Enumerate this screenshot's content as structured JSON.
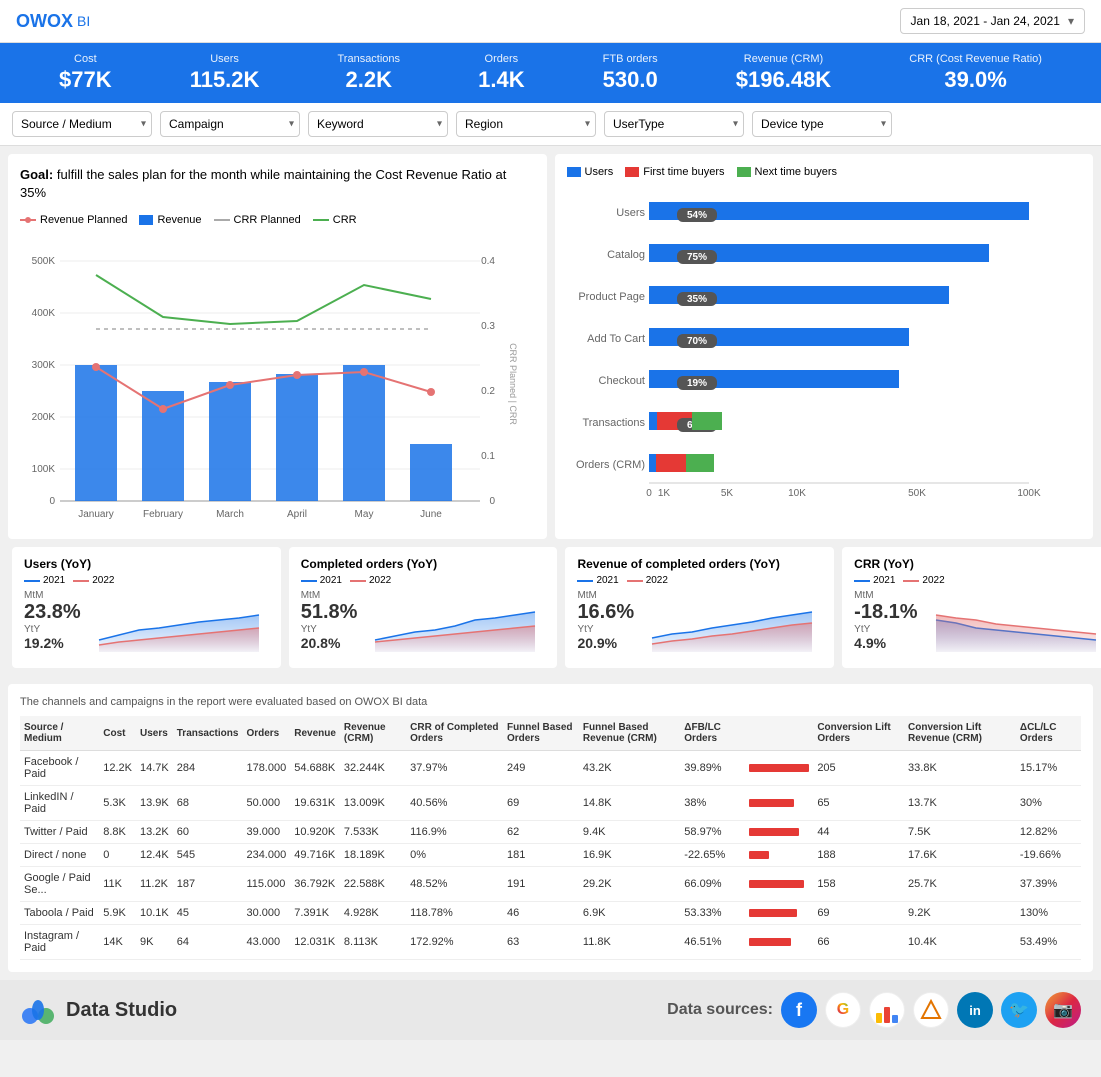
{
  "header": {
    "logo": "OWOX",
    "logo_suffix": "BI",
    "date_range": "Jan 18, 2021 - Jan 24, 2021"
  },
  "kpis": [
    {
      "label": "Cost",
      "value": "$77K"
    },
    {
      "label": "Users",
      "value": "115.2K"
    },
    {
      "label": "Transactions",
      "value": "2.2K"
    },
    {
      "label": "Orders",
      "value": "1.4K"
    },
    {
      "label": "FTB orders",
      "value": "530.0"
    },
    {
      "label": "Revenue (CRM)",
      "value": "$196.48K"
    },
    {
      "label": "CRR (Cost Revenue Ratio)",
      "value": "39.0%"
    }
  ],
  "filters": [
    {
      "label": "Source / Medium",
      "value": "Source / Medium"
    },
    {
      "label": "Campaign",
      "value": "Campaign"
    },
    {
      "label": "Keyword",
      "value": "Keyword"
    },
    {
      "label": "Region",
      "value": "Region"
    },
    {
      "label": "UserType",
      "value": "UserType"
    },
    {
      "label": "Device type",
      "value": "Device type"
    }
  ],
  "goal_text": "Goal: fulfill the sales plan for the month while maintaining the Cost Revenue Ratio at 35%",
  "chart1": {
    "legend": [
      {
        "label": "Revenue Planned",
        "color": "#e57373",
        "type": "line-dot"
      },
      {
        "label": "Revenue",
        "color": "#1a73e8",
        "type": "bar"
      },
      {
        "label": "CRR Planned",
        "color": "#aaa",
        "type": "line"
      },
      {
        "label": "CRR",
        "color": "#4caf50",
        "type": "line"
      }
    ],
    "months": [
      "January",
      "February",
      "March",
      "April",
      "May",
      "June"
    ],
    "y_left": [
      "500K",
      "400K",
      "300K",
      "200K",
      "100K",
      "0"
    ],
    "y_right": [
      "0.4",
      "0.3",
      "0.2",
      "0.1",
      "0"
    ]
  },
  "chart2": {
    "legend": [
      {
        "label": "Users",
        "color": "#1a73e8"
      },
      {
        "label": "First time buyers",
        "color": "#e53935"
      },
      {
        "label": "Next time buyers",
        "color": "#4caf50"
      }
    ],
    "categories": [
      "Users",
      "Catalog",
      "Product Page",
      "Add To Cart",
      "Checkout",
      "Transactions",
      "Orders (CRM)"
    ],
    "percentages": [
      "54%",
      "75%",
      "35%",
      "70%",
      "19%",
      "63%",
      ""
    ],
    "x_labels": [
      "0",
      "1K",
      "5K",
      "10K",
      "50K",
      "100K"
    ]
  },
  "small_charts": [
    {
      "title": "Users (YoY)",
      "mtm_label": "MtM",
      "mtm_value": "23.8%",
      "yty_label": "YtY",
      "yty_value": "19.2%",
      "legend": [
        {
          "label": "2021",
          "color": "#1a73e8"
        },
        {
          "label": "2022",
          "color": "#e57373"
        }
      ]
    },
    {
      "title": "Completed orders (YoY)",
      "mtm_label": "MtM",
      "mtm_value": "51.8%",
      "yty_label": "YtY",
      "yty_value": "20.8%",
      "legend": [
        {
          "label": "2021",
          "color": "#1a73e8"
        },
        {
          "label": "2022",
          "color": "#e57373"
        }
      ]
    },
    {
      "title": "Revenue of completed orders (YoY)",
      "mtm_label": "MtM",
      "mtm_value": "16.6%",
      "yty_label": "YtY",
      "yty_value": "20.9%",
      "legend": [
        {
          "label": "2021",
          "color": "#1a73e8"
        },
        {
          "label": "2022",
          "color": "#e57373"
        }
      ]
    },
    {
      "title": "CRR (YoY)",
      "mtm_label": "MtM",
      "mtm_value": "-18.1%",
      "yty_label": "YtY",
      "yty_value": "4.9%",
      "legend": [
        {
          "label": "2021",
          "color": "#1a73e8"
        },
        {
          "label": "2022",
          "color": "#e57373"
        }
      ]
    }
  ],
  "table": {
    "note": "The channels and campaigns in the report were evaluated based on OWOX BI data",
    "headers": [
      "Source / Medium",
      "Cost",
      "Users",
      "Transactions",
      "Orders",
      "Revenue",
      "Revenue (CRM)",
      "CRR of Completed Orders",
      "Funnel Based Orders",
      "Funnel Based Revenue (CRM)",
      "ΔFB/LC Orders",
      "",
      "Conversion Lift Orders",
      "Conversion Lift Revenue (CRM)",
      "ΔCL/LC Orders"
    ],
    "rows": [
      {
        "source": "Facebook / Paid",
        "cost": "12.2K",
        "users": "14.7K",
        "trans": "284",
        "orders": "178.000",
        "revenue": "54.688K",
        "rev_crm": "32.244K",
        "crr": "37.97%",
        "fb_orders": "249",
        "fb_rev": "43.2K",
        "delta_fb": "39.89%",
        "bar1": 60,
        "cl_orders": "205",
        "cl_rev": "33.8K",
        "delta_cl": "15.17%",
        "bar2": 30
      },
      {
        "source": "LinkedIN / Paid",
        "cost": "5.3K",
        "users": "13.9K",
        "trans": "68",
        "orders": "50.000",
        "revenue": "19.631K",
        "rev_crm": "13.009K",
        "crr": "40.56%",
        "fb_orders": "69",
        "fb_rev": "14.8K",
        "delta_fb": "38%",
        "bar1": 45,
        "cl_orders": "65",
        "cl_rev": "13.7K",
        "delta_cl": "30%",
        "bar2": 25
      },
      {
        "source": "Twitter / Paid",
        "cost": "8.8K",
        "users": "13.2K",
        "trans": "60",
        "orders": "39.000",
        "revenue": "10.920K",
        "rev_crm": "7.533K",
        "crr": "116.9%",
        "fb_orders": "62",
        "fb_rev": "9.4K",
        "delta_fb": "58.97%",
        "bar1": 50,
        "cl_orders": "44",
        "cl_rev": "7.5K",
        "delta_cl": "12.82%",
        "bar2": 20
      },
      {
        "source": "Direct / none",
        "cost": "0",
        "users": "12.4K",
        "trans": "545",
        "orders": "234.000",
        "revenue": "49.716K",
        "rev_crm": "18.189K",
        "crr": "0%",
        "fb_orders": "181",
        "fb_rev": "16.9K",
        "delta_fb": "-22.65%",
        "bar1": 20,
        "cl_orders": "188",
        "cl_rev": "17.6K",
        "delta_cl": "-19.66%",
        "bar2": 18
      },
      {
        "source": "Google / Paid Se...",
        "cost": "11K",
        "users": "11.2K",
        "trans": "187",
        "orders": "115.000",
        "revenue": "36.792K",
        "rev_crm": "22.588K",
        "crr": "48.52%",
        "fb_orders": "191",
        "fb_rev": "29.2K",
        "delta_fb": "66.09%",
        "bar1": 55,
        "cl_orders": "158",
        "cl_rev": "25.7K",
        "delta_cl": "37.39%",
        "bar2": 40
      },
      {
        "source": "Taboola / Paid",
        "cost": "5.9K",
        "users": "10.1K",
        "trans": "45",
        "orders": "30.000",
        "revenue": "7.391K",
        "rev_crm": "4.928K",
        "crr": "118.78%",
        "fb_orders": "46",
        "fb_rev": "6.9K",
        "delta_fb": "53.33%",
        "bar1": 48,
        "cl_orders": "69",
        "cl_rev": "9.2K",
        "delta_cl": "130%",
        "bar2": 55
      },
      {
        "source": "Instagram / Paid",
        "cost": "14K",
        "users": "9K",
        "trans": "64",
        "orders": "43.000",
        "revenue": "12.031K",
        "rev_crm": "8.113K",
        "crr": "172.92%",
        "fb_orders": "63",
        "fb_rev": "11.8K",
        "delta_fb": "46.51%",
        "bar1": 42,
        "cl_orders": "66",
        "cl_rev": "10.4K",
        "delta_cl": "53.49%",
        "bar2": 35
      }
    ]
  },
  "footer": {
    "ds_label": "Data Studio",
    "sources_label": "Data sources:",
    "social": [
      {
        "name": "facebook",
        "color": "#1877f2",
        "symbol": "f"
      },
      {
        "name": "google",
        "color": "#fff",
        "symbol": "G"
      },
      {
        "name": "google-ads",
        "color": "#fff",
        "symbol": "▲"
      },
      {
        "name": "linkedin",
        "color": "#0077b5",
        "symbol": "in"
      },
      {
        "name": "twitter",
        "color": "#1da1f2",
        "symbol": "🐦"
      },
      {
        "name": "instagram",
        "color": "#e1306c",
        "symbol": "📷"
      }
    ]
  }
}
